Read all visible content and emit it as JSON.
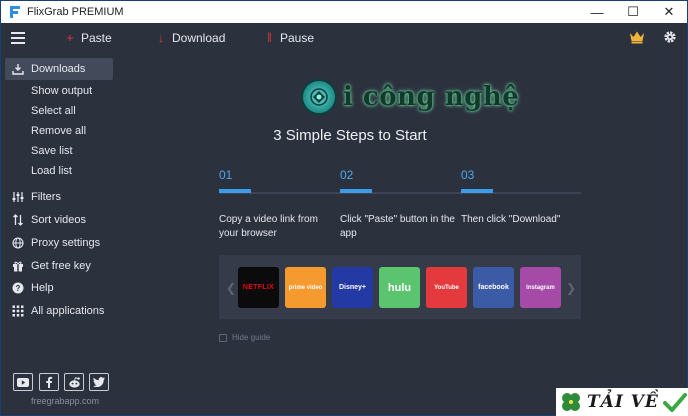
{
  "window": {
    "title": "FlixGrab PREMIUM",
    "controls": {
      "minimize": "—",
      "maximize": "☐",
      "close": "✕"
    }
  },
  "toolbar": {
    "paste_label": "Paste",
    "download_label": "Download",
    "pause_label": "Pause",
    "paste_icon": "+",
    "download_icon": "↓",
    "pause_icon": "||",
    "accent_color": "#e23a3a",
    "right_icons": [
      "crown-icon",
      "gear-icon"
    ]
  },
  "sidebar": {
    "downloads": "Downloads",
    "sub_items": [
      "Show output",
      "Select all",
      "Remove all",
      "Save list",
      "Load list"
    ],
    "items": [
      "Filters",
      "Sort videos",
      "Proxy settings",
      "Get free key",
      "Help",
      "All applications"
    ],
    "site": "freegrabapp.com",
    "social_icons": [
      "youtube-icon",
      "facebook-icon",
      "reddit-icon",
      "twitter-icon"
    ]
  },
  "main": {
    "watermark": "i công nghệ",
    "steps_title": "3 Simple Steps to Start",
    "steps": [
      {
        "num": "01",
        "text": "Copy a video link from your browser"
      },
      {
        "num": "02",
        "text": "Click \"Paste\" button in the app"
      },
      {
        "num": "03",
        "text": "Then click \"Download\""
      }
    ],
    "services": [
      {
        "name": "NETFLIX",
        "color": "#0b0b0b"
      },
      {
        "name": "prime video",
        "color": "#f59a2e"
      },
      {
        "name": "Disney+",
        "color": "#233aa5"
      },
      {
        "name": "hulu",
        "color": "#5ac46e"
      },
      {
        "name": "YouTube",
        "color": "#e43a3e"
      },
      {
        "name": "facebook",
        "color": "#3c5ba7"
      },
      {
        "name": "Instagram",
        "color": "#a64aa8"
      }
    ],
    "hide_guide": "Hide guide"
  },
  "badge": {
    "text": "TẢI VỀ"
  }
}
